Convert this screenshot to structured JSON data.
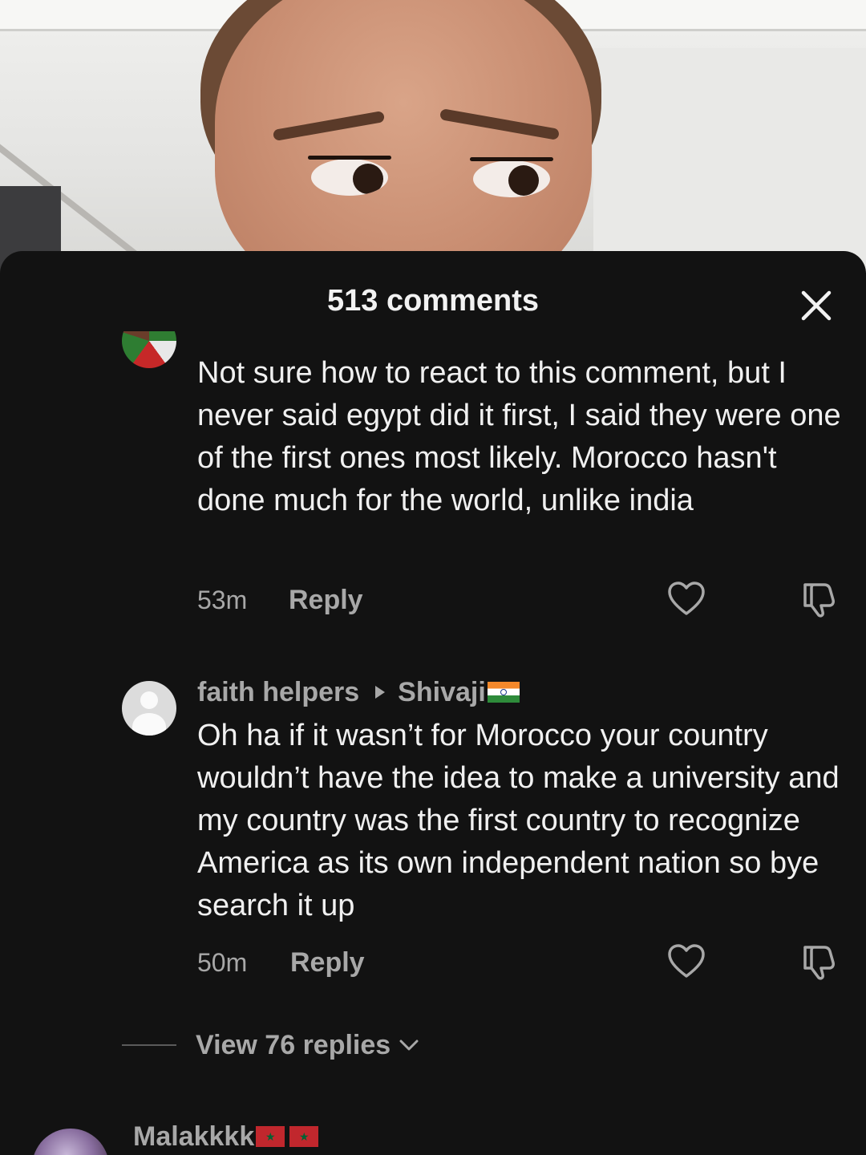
{
  "sheet": {
    "title": "513 comments"
  },
  "comments": [
    {
      "text": "Not sure how to react to this comment, but I never said egypt did it first, I said they were one of the first ones most likely. Morocco hasn't done much for the world, unlike india",
      "time": "53m",
      "reply_label": "Reply"
    },
    {
      "author": "faith helpers",
      "reply_to": "Shivaji",
      "reply_to_flag": "india-flag",
      "text": "Oh ha if it wasn’t for Morocco your country wouldn’t have the idea to make a university and my country was the first country to recognize America as its own independent nation so bye search it up",
      "time": "50m",
      "reply_label": "Reply",
      "view_replies_label": "View 76 replies"
    },
    {
      "author": "Malakkkk",
      "author_flags": [
        "morocco-flag",
        "morocco-flag"
      ]
    }
  ],
  "icons": {
    "close": "close-icon",
    "like": "heart-icon",
    "dislike": "thumbs-down-icon",
    "expand": "chevron-down-icon"
  },
  "colors": {
    "sheet_bg": "#121212",
    "primary_text": "#f0f0f0",
    "secondary_text": "#a8a8a8"
  }
}
